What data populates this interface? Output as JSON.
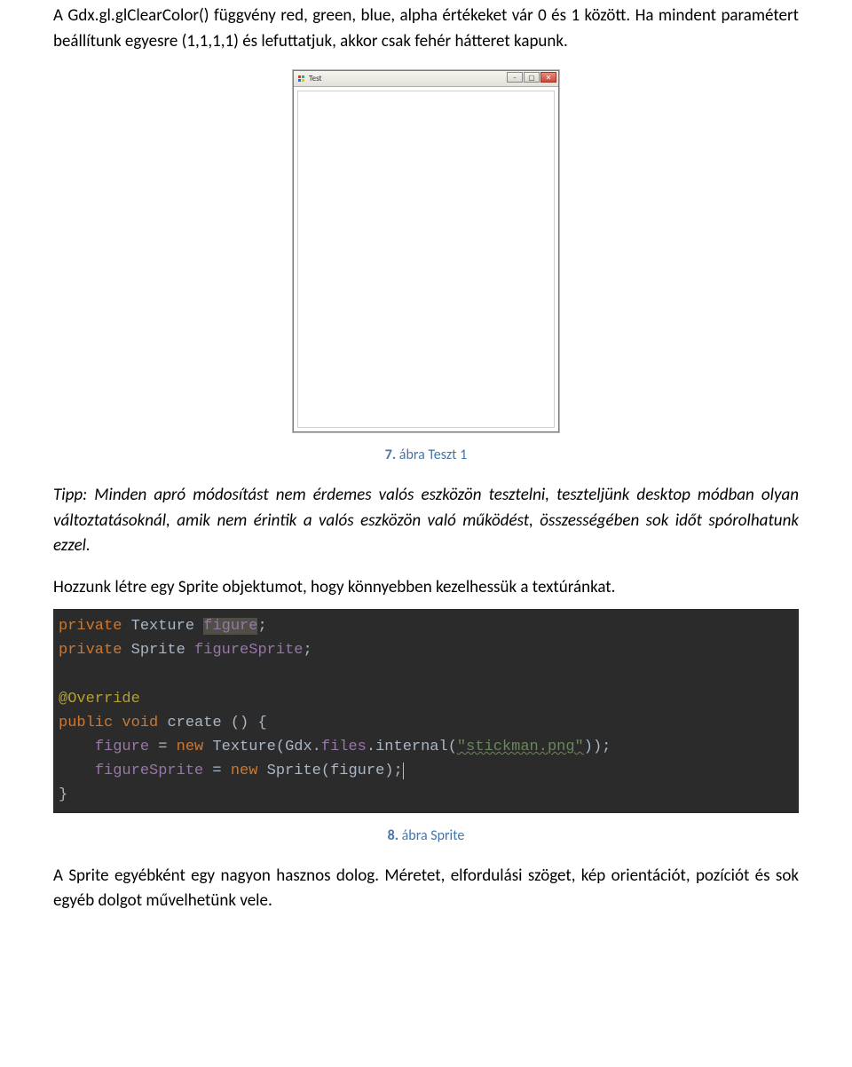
{
  "intro": "A Gdx.gl.glClearColor() függvény red, green, blue, alpha értékeket vár 0 és 1 között. Ha mindent paramétert beállítunk egyesre (1,1,1,1) és lefuttatjuk, akkor csak fehér hátteret kapunk.",
  "window": {
    "title": "Test"
  },
  "caption1_num": "7.",
  "caption1_text": " ábra Teszt 1",
  "tip": "Tipp: Minden apró módosítást nem érdemes valós eszközön tesztelni, teszteljünk desktop módban olyan változtatásoknál, amik nem érintik a valós eszközön való működést, összességében sok időt spórolhatunk ezzel.",
  "sprite_intro": "Hozzunk létre egy Sprite objektumot, hogy könnyebben kezelhessük a textúránkat.",
  "code": {
    "l1_kw1": "private",
    "l1_type": "Texture",
    "l1_name": "figure",
    "l1_semi": ";",
    "l2_kw1": "private",
    "l2_type": "Sprite",
    "l2_name": "figureSprite",
    "l2_semi": ";",
    "l3_ann": "@Override",
    "l4_kw1": "public",
    "l4_kw2": "void",
    "l4_name": "create",
    "l4_paren": "() {",
    "l5_ind": "    ",
    "l5_lhs": "figure",
    "l5_eq": " = ",
    "l5_kw": "new",
    "l5_rest1": " Texture(Gdx.",
    "l5_files": "files",
    "l5_rest2": ".internal(",
    "l5_str": "\"stickman.png\"",
    "l5_rest3": "));",
    "l6_ind": "    ",
    "l6_lhs": "figureSprite",
    "l6_eq": " = ",
    "l6_kw": "new",
    "l6_rest": " Sprite(figure);",
    "l7": "}"
  },
  "caption2_num": "8.",
  "caption2_text": " ábra Sprite",
  "outro": "A Sprite egyébként egy nagyon hasznos dolog. Méretet, elfordulási szöget, kép orientációt, pozíciót és sok egyéb dolgot művelhetünk vele."
}
